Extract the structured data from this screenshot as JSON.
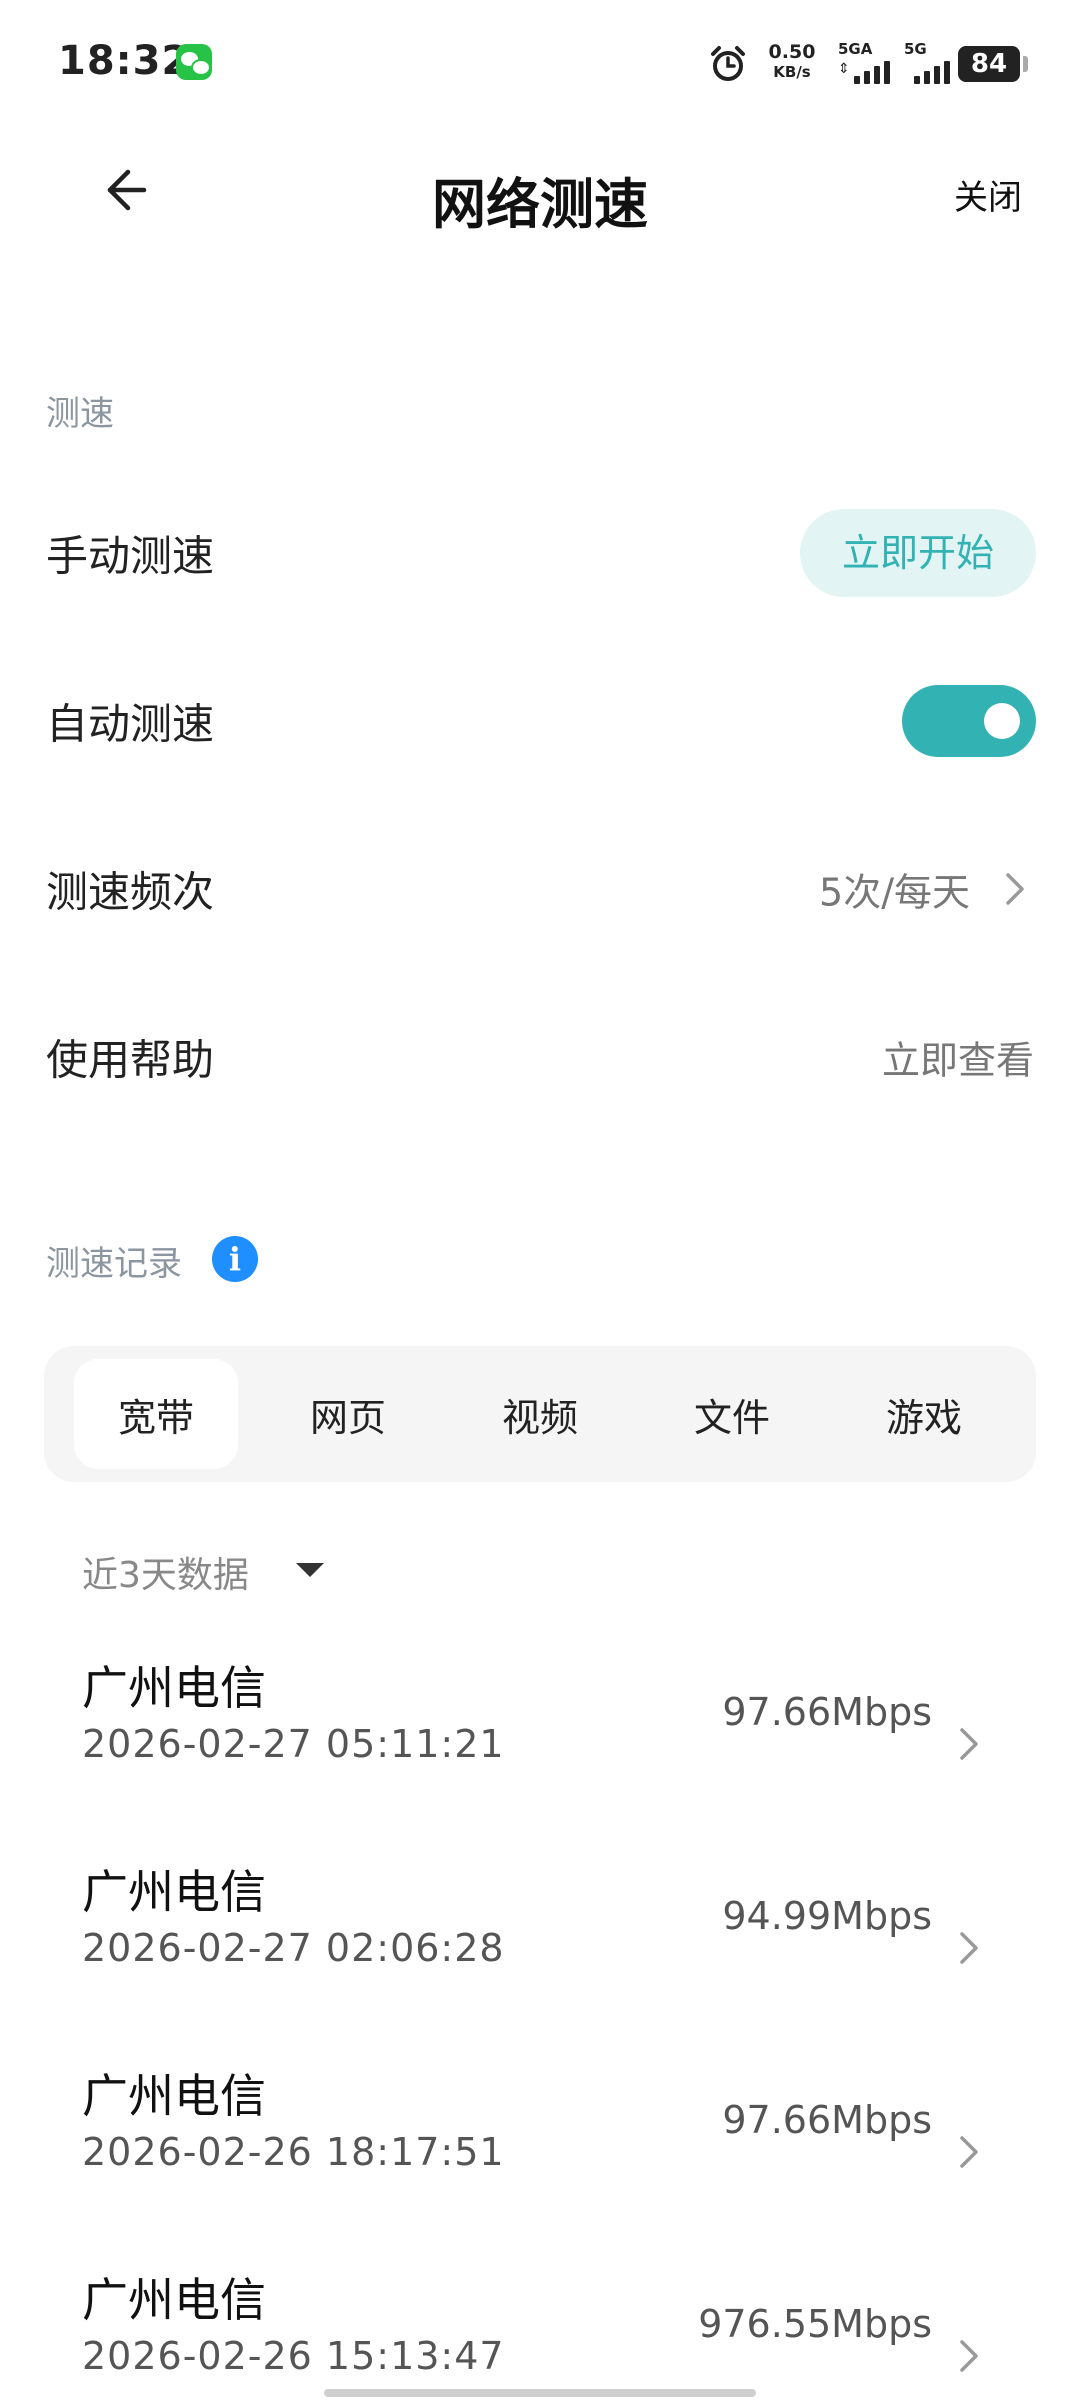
{
  "status_bar": {
    "time": "18:32",
    "net_speed_value": "0.50",
    "net_speed_unit": "KB/s",
    "sim1_label": "5GA",
    "sim2_label": "5G",
    "battery": "84"
  },
  "header": {
    "title": "网络测速",
    "close_label": "关闭"
  },
  "speedtest_section": {
    "label": "测速",
    "manual": {
      "title": "手动测速",
      "button": "立即开始"
    },
    "auto": {
      "title": "自动测速",
      "enabled": true
    },
    "frequency": {
      "title": "测速频次",
      "value": "5次/每天"
    },
    "help": {
      "title": "使用帮助",
      "value": "立即查看"
    }
  },
  "records_section": {
    "label": "测速记录",
    "tabs": [
      {
        "label": "宽带",
        "active": true
      },
      {
        "label": "网页",
        "active": false
      },
      {
        "label": "视频",
        "active": false
      },
      {
        "label": "文件",
        "active": false
      },
      {
        "label": "游戏",
        "active": false
      }
    ],
    "filter": "近3天数据",
    "records": [
      {
        "isp": "广州电信",
        "time": "2026-02-27 05:11:21",
        "speed": "97.66Mbps"
      },
      {
        "isp": "广州电信",
        "time": "2026-02-27 02:06:28",
        "speed": "94.99Mbps"
      },
      {
        "isp": "广州电信",
        "time": "2026-02-26 18:17:51",
        "speed": "97.66Mbps"
      },
      {
        "isp": "广州电信",
        "time": "2026-02-26 15:13:47",
        "speed": "976.55Mbps"
      }
    ]
  },
  "colors": {
    "accent": "#33b2b4",
    "accent_light": "#e3f4f4",
    "section_label": "#8c96a0",
    "info_blue": "#1f8fff"
  }
}
